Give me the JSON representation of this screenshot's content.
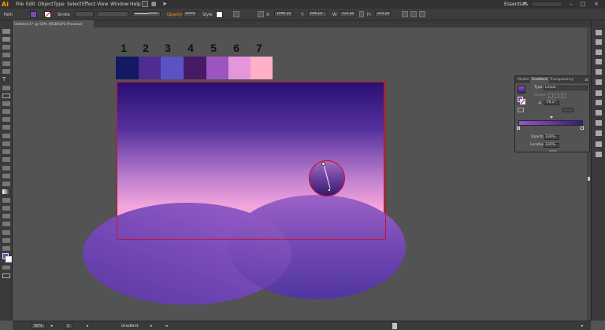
{
  "app": {
    "logo": "Ai",
    "menu": [
      "File",
      "Edit",
      "Object",
      "Type",
      "Select",
      "Effect",
      "View",
      "Window",
      "Help"
    ],
    "workspace": "Essentials",
    "window_buttons": [
      "–",
      "□",
      "×"
    ]
  },
  "controlbar": {
    "selection": "Path",
    "stroke_label": "Stroke",
    "brush": "Basic",
    "opacity_label": "Opacity",
    "opacity_value": "100%",
    "style_label": "Style",
    "x_label": "X:",
    "x_value": "1090 px",
    "y_label": "Y:",
    "y_value": "606 px",
    "w_label": "W:",
    "w_value": "222 px",
    "h_label": "H:",
    "h_value": "222 px"
  },
  "document": {
    "tab_title": "Untitled-1* @ 50% (RGB/GPU Preview)"
  },
  "swatches": {
    "labels": [
      "1",
      "2",
      "3",
      "4",
      "5",
      "6",
      "7"
    ],
    "colors": [
      "#131a62",
      "#4d2d8f",
      "#5d52c3",
      "#461a65",
      "#9c55c0",
      "#e595da",
      "#ffafc6"
    ]
  },
  "gradient_panel": {
    "tabs": [
      "Stroke",
      "Gradient",
      "Transparency"
    ],
    "active_tab": "Gradient",
    "type_label": "Type:",
    "type_value": "Linear",
    "stroke_label": "Stroke:",
    "angle_value": "-78.2°",
    "opacity_label": "Opacity:",
    "opacity_value": "100%",
    "location_label": "Location:",
    "location_value": "100%",
    "stop_colors": [
      "#9657c2",
      "#3b1a78"
    ]
  },
  "statusbar": {
    "zoom": "50%",
    "page": "1",
    "tool": "Gradient"
  },
  "colors": {
    "artboard_border": "#c8102e",
    "ui_dark": "#3a3a3a",
    "canvas": "#535353"
  }
}
